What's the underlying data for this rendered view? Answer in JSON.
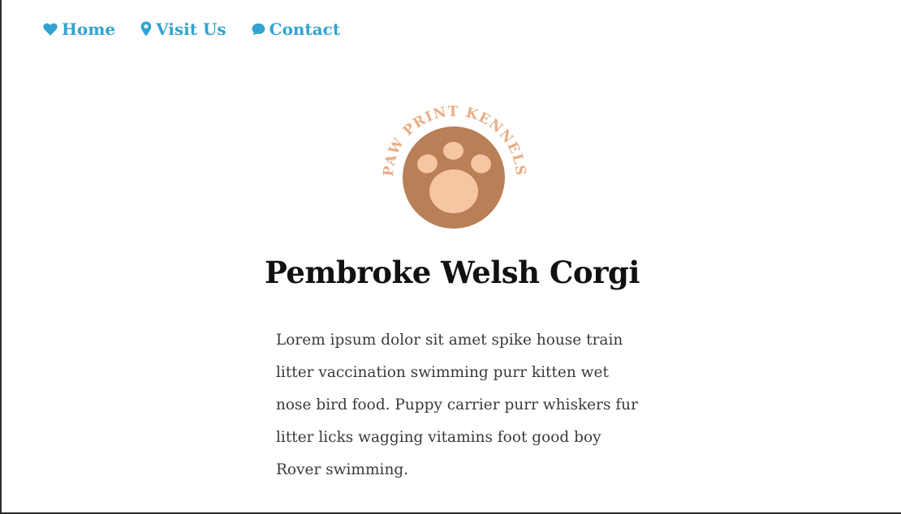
{
  "nav": {
    "items": [
      {
        "label": "Home",
        "icon": "heart-icon"
      },
      {
        "label": "Visit Us",
        "icon": "map-pin-icon"
      },
      {
        "label": "Contact",
        "icon": "speech-bubble-icon"
      }
    ]
  },
  "logo": {
    "text": "PAW PRINT KENNELS",
    "icon": "paw-print-icon"
  },
  "page": {
    "title": "Pembroke Welsh Corgi",
    "body": "Lorem ipsum dolor sit amet spike house train litter vaccination swimming purr kitten wet nose bird food. Puppy carrier purr whiskers fur litter licks wagging vitamins foot good boy Rover swimming."
  },
  "colors": {
    "accent": "#34a3cf",
    "logo_circle": "#b97f57",
    "logo_paw": "#f6c5a2",
    "logo_text": "#e8ad85",
    "title_text": "#111111",
    "body_text": "#3a3a3a"
  }
}
